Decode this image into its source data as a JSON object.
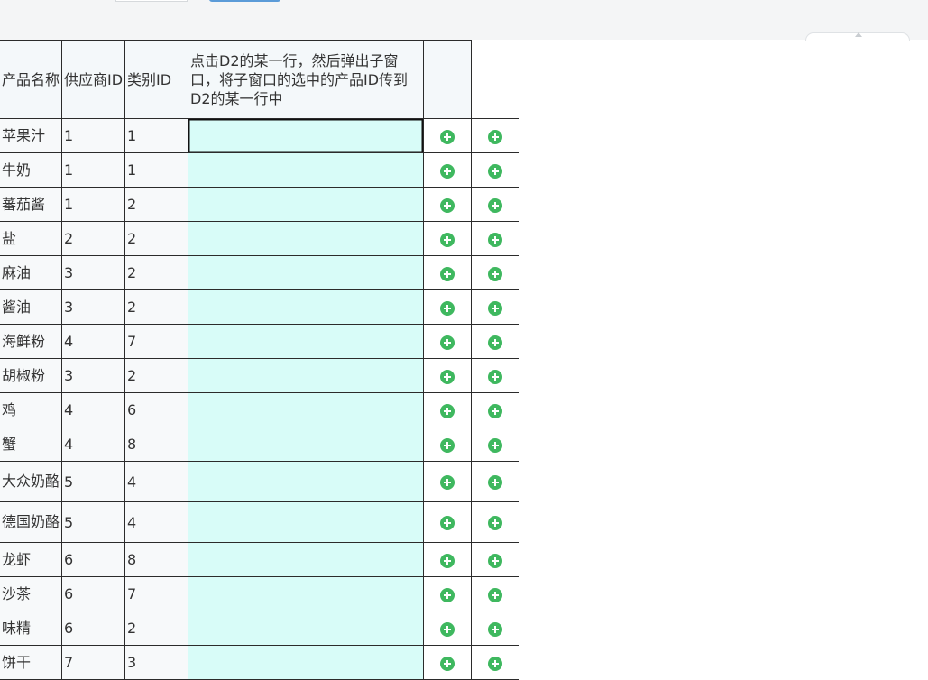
{
  "colors": {
    "d2_cell_bg": "#d8fcf8",
    "add_icon": "#3fb85f",
    "header_bg": "#f4f8fa",
    "toolbar_bg": "#f4f5f6"
  },
  "table": {
    "headers": {
      "product_name": "产品名称",
      "supplier_id": "供应商ID",
      "category_id": "类别ID",
      "d2_instruction": "点击D2的某一行，然后弹出子窗口，将子窗口的选中的产品ID传到D2的某一行中"
    },
    "rows": [
      {
        "name": "苹果汁",
        "supplier": "1",
        "category": "1",
        "d2": ""
      },
      {
        "name": "牛奶",
        "supplier": "1",
        "category": "1",
        "d2": ""
      },
      {
        "name": "蕃茄酱",
        "supplier": "1",
        "category": "2",
        "d2": ""
      },
      {
        "name": "盐",
        "supplier": "2",
        "category": "2",
        "d2": ""
      },
      {
        "name": "麻油",
        "supplier": "3",
        "category": "2",
        "d2": ""
      },
      {
        "name": "酱油",
        "supplier": "3",
        "category": "2",
        "d2": ""
      },
      {
        "name": "海鲜粉",
        "supplier": "4",
        "category": "7",
        "d2": ""
      },
      {
        "name": "胡椒粉",
        "supplier": "3",
        "category": "2",
        "d2": ""
      },
      {
        "name": "鸡",
        "supplier": "4",
        "category": "6",
        "d2": ""
      },
      {
        "name": "蟹",
        "supplier": "4",
        "category": "8",
        "d2": ""
      },
      {
        "name": "大众奶酪",
        "supplier": "5",
        "category": "4",
        "d2": ""
      },
      {
        "name": "德国奶酪",
        "supplier": "5",
        "category": "4",
        "d2": ""
      },
      {
        "name": "龙虾",
        "supplier": "6",
        "category": "8",
        "d2": ""
      },
      {
        "name": "沙茶",
        "supplier": "6",
        "category": "7",
        "d2": ""
      },
      {
        "name": "味精",
        "supplier": "6",
        "category": "2",
        "d2": ""
      },
      {
        "name": "饼干",
        "supplier": "7",
        "category": "3",
        "d2": ""
      }
    ],
    "row_icons": [
      "add-circle-icon",
      "add-circle-icon"
    ]
  }
}
